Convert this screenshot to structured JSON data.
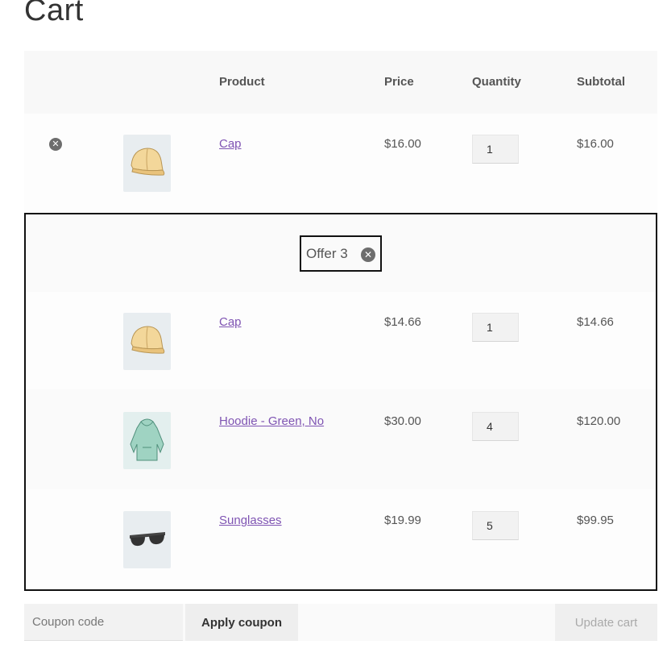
{
  "page": {
    "title": "Cart"
  },
  "table": {
    "headers": {
      "product": "Product",
      "price": "Price",
      "quantity": "Quantity",
      "subtotal": "Subtotal"
    }
  },
  "items": [
    {
      "name": "Cap",
      "price": "$16.00",
      "qty": "1",
      "subtotal": "$16.00",
      "image": "cap-image"
    }
  ],
  "offer": {
    "label": "Offer 3",
    "items": [
      {
        "name": "Cap",
        "price": "$14.66",
        "qty": "1",
        "subtotal": "$14.66",
        "image": "cap-image"
      },
      {
        "name": "Hoodie - Green, No",
        "price": "$30.00",
        "qty": "4",
        "subtotal": "$120.00",
        "image": "hoodie-image"
      },
      {
        "name": "Sunglasses",
        "price": "$19.99",
        "qty": "5",
        "subtotal": "$99.95",
        "image": "sunglasses-image"
      }
    ]
  },
  "actions": {
    "coupon_placeholder": "Coupon code",
    "apply_label": "Apply coupon",
    "update_label": "Update cart"
  },
  "icons": {
    "remove": "close-circle-icon",
    "remove_glyph": "✕"
  },
  "colors": {
    "link": "#7f54b3",
    "border": "#111111"
  }
}
